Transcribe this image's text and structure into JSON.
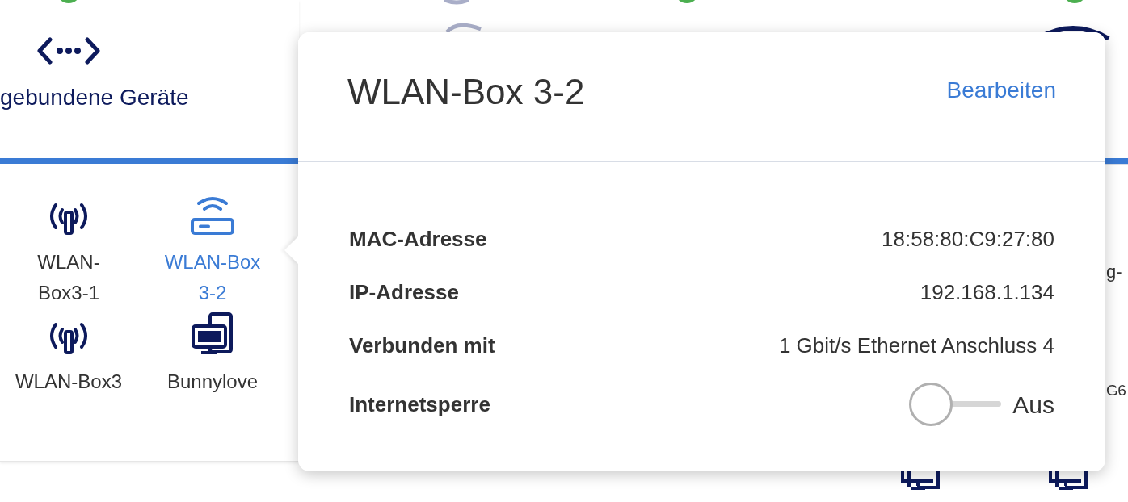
{
  "tab": {
    "label": "gebundene Geräte",
    "selected": true
  },
  "devices": [
    {
      "kind": "repeater",
      "lines": [
        "WLAN-",
        "Box3-1"
      ],
      "selected": false
    },
    {
      "kind": "router",
      "lines": [
        "WLAN-Box",
        "3-2"
      ],
      "selected": true
    },
    {
      "kind": "repeater",
      "lines": [
        "WLAN-Box3"
      ],
      "selected": false
    },
    {
      "kind": "computer",
      "lines": [
        "Bunnylove"
      ],
      "selected": false
    }
  ],
  "right_fragments": [
    "g-",
    "G6"
  ],
  "popover": {
    "title": "WLAN-Box 3-2",
    "edit_link": "Bearbeiten",
    "fields": [
      {
        "label": "MAC-Adresse",
        "value": "18:58:80:C9:27:80"
      },
      {
        "label": "IP-Adresse",
        "value": "192.168.1.134"
      },
      {
        "label": "Verbunden mit",
        "value": "1 Gbit/s Ethernet Anschluss 4"
      }
    ],
    "internet_lock": {
      "label": "Internetsperre",
      "on": false,
      "state_text": "Aus"
    }
  }
}
